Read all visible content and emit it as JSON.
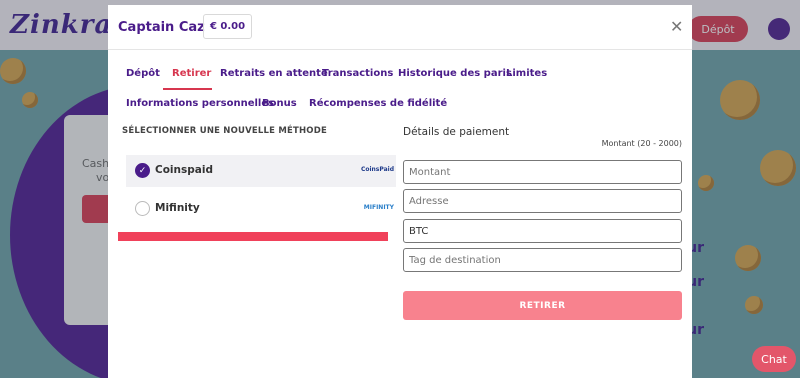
{
  "background": {
    "logo": "Zinkra",
    "depot_label": "Dépôt",
    "chat_label": "Chat",
    "card_text_1": "Cash",
    "card_text_2": "vo",
    "right_letters": [
      "ur",
      "ur",
      "ur"
    ]
  },
  "modal": {
    "title": "Captain Caz",
    "balance": "€ 0.00",
    "close_icon": "close-icon",
    "tabs_row1": [
      "Dépôt",
      "Retirer",
      "Retraits en attente",
      "Transactions",
      "Historique des paris",
      "Limites"
    ],
    "tabs_row2": [
      "Informations personnelles",
      "Bonus",
      "Récompenses de fidélité"
    ],
    "active_tab": "Retirer",
    "section_title": "SÉLECTIONNER UNE NOUVELLE MÉTHODE",
    "methods": [
      {
        "name": "Coinspaid",
        "logo": "CoinsPaid",
        "selected": true
      },
      {
        "name": "Mifinity",
        "logo": "MIFINITY",
        "selected": false
      }
    ],
    "payment": {
      "title": "Détails de paiement",
      "amount_range": "Montant (20 - 2000)",
      "fields": [
        {
          "placeholder": "Montant",
          "value": ""
        },
        {
          "placeholder": "Adresse",
          "value": ""
        },
        {
          "placeholder": "BTC",
          "value": "BTC"
        },
        {
          "placeholder": "Tag de destination",
          "value": ""
        }
      ],
      "submit_label": "RETIRER"
    }
  },
  "colors": {
    "brand_purple": "#4a1c8a",
    "accent_red": "#d7364f",
    "button_pink": "#f8828e"
  }
}
